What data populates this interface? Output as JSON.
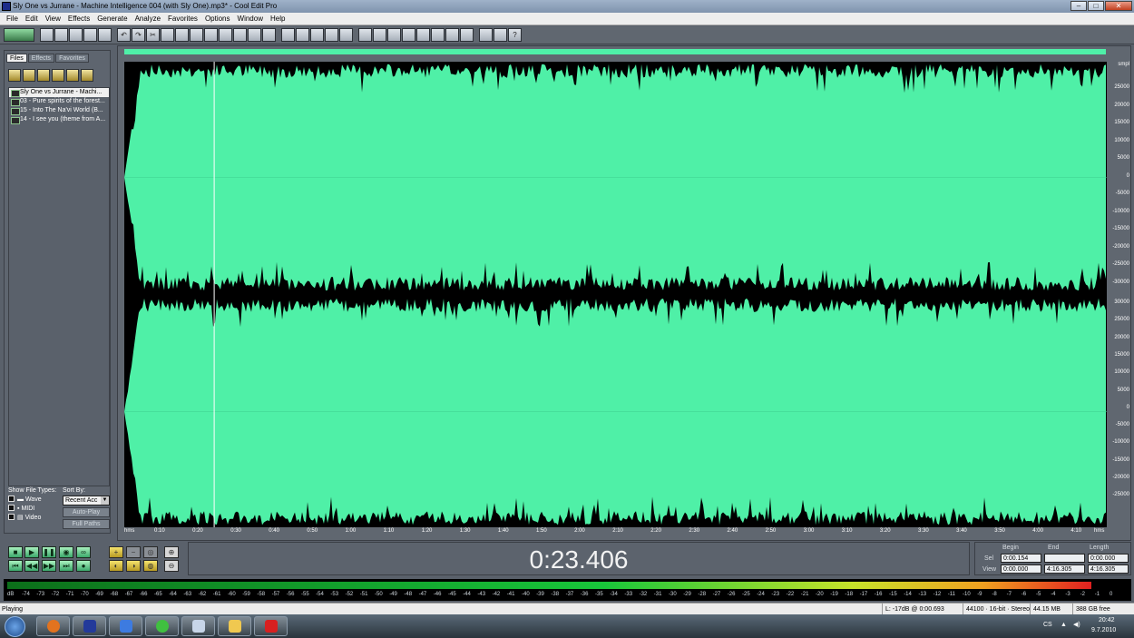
{
  "window": {
    "title": "Sly One vs Jurrane - Machine Intelligence 004 (with Sly One).mp3* - Cool Edit Pro"
  },
  "menu": [
    "File",
    "Edit",
    "View",
    "Effects",
    "Generate",
    "Analyze",
    "Favorites",
    "Options",
    "Window",
    "Help"
  ],
  "left_panel": {
    "tabs": [
      "Files",
      "Effects",
      "Favorites"
    ],
    "files": [
      "Sly One vs Jurrane - Machi...",
      "03 - Pure spirits of the forest...",
      "15 - Into The Na'vi World (B...",
      "14 - I see you (theme from A..."
    ],
    "show_file_types_label": "Show File Types:",
    "sort_by_label": "Sort By:",
    "file_types": [
      "Wave",
      "MIDI",
      "Video"
    ],
    "sort_value": "Recent Acc",
    "auto_play": "Auto-Play",
    "full_paths": "Full Paths"
  },
  "waveform": {
    "amplitude_unit": "smpl",
    "amplitude_labels_top": [
      "25000",
      "20000",
      "15000",
      "10000",
      "5000",
      "0",
      "-5000",
      "-10000",
      "-15000",
      "-20000",
      "-25000",
      "-30000"
    ],
    "amplitude_labels_bottom": [
      "30000",
      "25000",
      "20000",
      "15000",
      "10000",
      "5000",
      "0",
      "-5000",
      "-10000",
      "-15000",
      "-20000",
      "-25000"
    ],
    "time_labels": [
      "hms",
      "0:10",
      "0:20",
      "0:30",
      "0:40",
      "0:50",
      "1:00",
      "1:10",
      "1:20",
      "1:30",
      "1:40",
      "1:50",
      "2:00",
      "2:10",
      "2:20",
      "2:30",
      "2:40",
      "2:50",
      "3:00",
      "3:10",
      "3:20",
      "3:30",
      "3:40",
      "3:50",
      "4:00",
      "4:10",
      "hms"
    ],
    "playhead_fraction": 0.0915,
    "wave_color": "#4ff0a7"
  },
  "transport": {
    "time": "0:23.406"
  },
  "selection": {
    "headers": [
      "Begin",
      "End",
      "Length"
    ],
    "rows": [
      {
        "label": "Sel",
        "begin": "0:00.154",
        "end": "",
        "length": "0:00.000"
      },
      {
        "label": "View",
        "begin": "0:00.000",
        "end": "4:16.305",
        "length": "4:16.305"
      }
    ]
  },
  "level_meter": {
    "db_labels": [
      "dB",
      "-74",
      "-73",
      "-72",
      "-71",
      "-70",
      "-69",
      "-68",
      "-67",
      "-66",
      "-65",
      "-64",
      "-63",
      "-62",
      "-61",
      "-60",
      "-59",
      "-58",
      "-57",
      "-56",
      "-55",
      "-54",
      "-53",
      "-52",
      "-51",
      "-50",
      "-49",
      "-48",
      "-47",
      "-46",
      "-45",
      "-44",
      "-43",
      "-42",
      "-41",
      "-40",
      "-39",
      "-38",
      "-37",
      "-36",
      "-35",
      "-34",
      "-33",
      "-32",
      "-31",
      "-30",
      "-29",
      "-28",
      "-27",
      "-26",
      "-25",
      "-24",
      "-23",
      "-22",
      "-21",
      "-20",
      "-19",
      "-18",
      "-17",
      "-16",
      "-15",
      "-14",
      "-13",
      "-12",
      "-11",
      "-10",
      "-9",
      "-8",
      "-7",
      "-6",
      "-5",
      "-4",
      "-3",
      "-2",
      "-1",
      "0"
    ],
    "level_fraction": 0.97
  },
  "status": {
    "state": "Playing",
    "level": "L: -17dB @  0:00.693",
    "format": "44100 · 16-bit · Stereo",
    "size": "44.15 MB",
    "free": "388 GB free"
  },
  "taskbar": {
    "lang": "CS",
    "time": "20:42",
    "date": "9.7.2010"
  },
  "colors": {
    "accent": "#4ff0a7",
    "panel": "#606770"
  }
}
